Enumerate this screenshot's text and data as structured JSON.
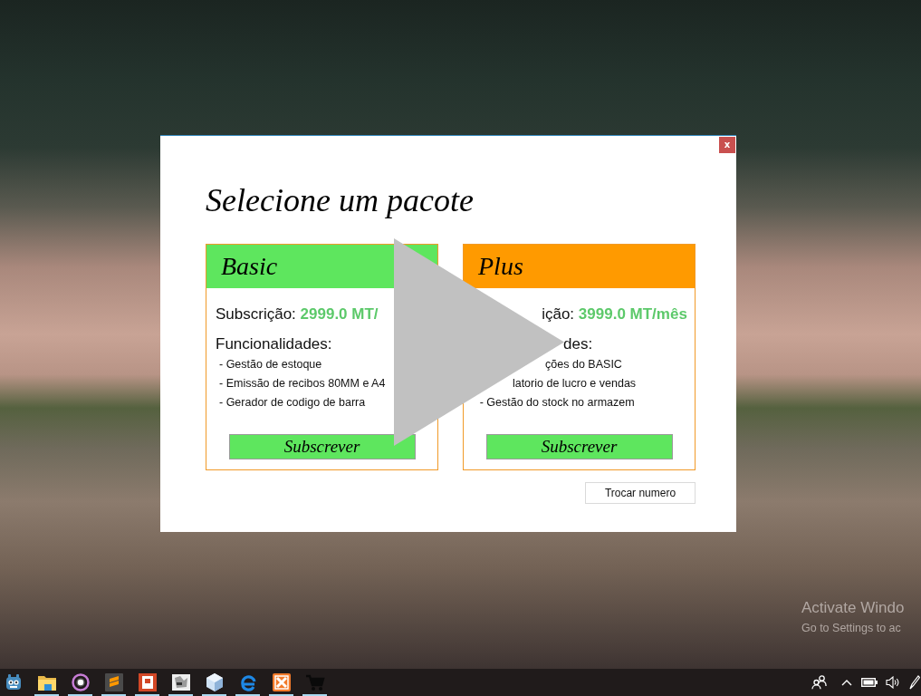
{
  "desktop": {
    "activation_notice": {
      "title": "Activate Windo",
      "subtitle": "Go to Settings to ac"
    }
  },
  "dialog": {
    "close_label": "x",
    "title": "Selecione um pacote",
    "plans": [
      {
        "name": "Basic",
        "color": "#5ee65e",
        "subscription_label": "Subscrição:",
        "price": "2999.0 MT/",
        "features_heading": "Funcionalidades:",
        "features": [
          "- Gestão de estoque",
          "- Emissão de recibos 80MM e A4",
          "- Gerador de codigo de barra"
        ],
        "button": "Subscrever"
      },
      {
        "name": "Plus",
        "color": "#ff9a00",
        "subscription_label": "ição:",
        "price": "3999.0 MT/mês",
        "features_heading": "des:",
        "features": [
          "ções do BASIC",
          "latorio de lucro e vendas",
          "- Gestão do stock no armazem"
        ],
        "button": "Subscrever"
      }
    ],
    "change_number_button": "Trocar numero"
  },
  "taskbar": {
    "apps": [
      {
        "running": false
      },
      {
        "running": true
      },
      {
        "running": true
      },
      {
        "running": true
      },
      {
        "running": true
      },
      {
        "running": true
      },
      {
        "running": true
      },
      {
        "running": true
      },
      {
        "running": true
      },
      {
        "running": true
      }
    ]
  }
}
